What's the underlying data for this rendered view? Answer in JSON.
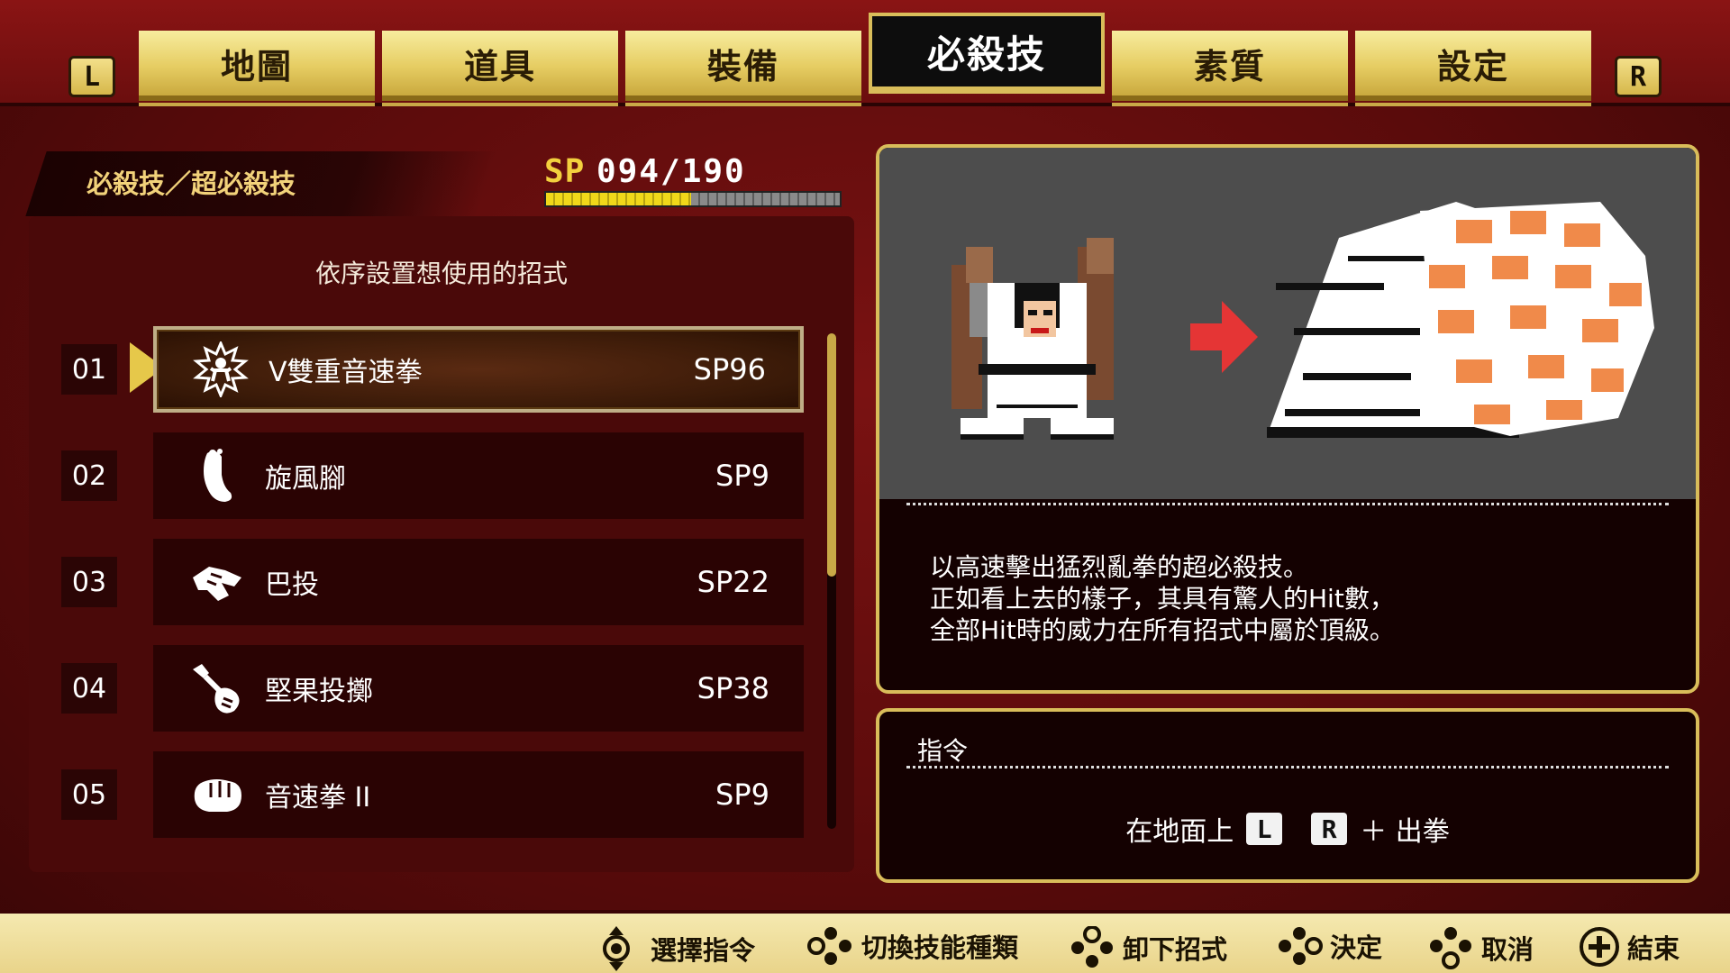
{
  "shoulder": {
    "left": "L",
    "right": "R"
  },
  "tabs": [
    {
      "label": "地圖"
    },
    {
      "label": "道具"
    },
    {
      "label": "裝備"
    },
    {
      "label": "必殺技"
    },
    {
      "label": "素質"
    },
    {
      "label": "設定"
    }
  ],
  "section": {
    "title": "必殺技／超必殺技"
  },
  "sp": {
    "label": "SP",
    "value": "094/190",
    "current": 94,
    "max": 190
  },
  "list": {
    "instruction": "依序設置想使用的招式",
    "items": [
      {
        "num": "01",
        "name": "V雙重音速拳",
        "cost": "SP96",
        "icon": "burst-figure-icon"
      },
      {
        "num": "02",
        "name": "旋風腳",
        "cost": "SP9",
        "icon": "foot-icon"
      },
      {
        "num": "03",
        "name": "巴投",
        "cost": "SP22",
        "icon": "grab-throw-icon"
      },
      {
        "num": "04",
        "name": "堅果投擲",
        "cost": "SP38",
        "icon": "throw-hand-icon"
      },
      {
        "num": "05",
        "name": "音速拳 II",
        "cost": "SP9",
        "icon": "fist-icon"
      }
    ]
  },
  "detail": {
    "description": [
      "以高速擊出猛烈亂拳的超必殺技。",
      "正如看上去的樣子，其具有驚人的Hit數，",
      "全部Hit時的威力在所有招式中屬於頂級。"
    ]
  },
  "command": {
    "title": "指令",
    "prefix": "在地面上",
    "key1": "L",
    "key2": "R",
    "suffix": "＋ 出拳"
  },
  "footer": {
    "hints": [
      {
        "label": "選擇指令",
        "icon": "dpad-updown-icon"
      },
      {
        "label": "切換技能種類",
        "icon": "buttons-left-icon"
      },
      {
        "label": "卸下招式",
        "icon": "buttons-top-icon"
      },
      {
        "label": "決定",
        "icon": "buttons-right-icon"
      },
      {
        "label": "取消",
        "icon": "buttons-bottom-icon"
      },
      {
        "label": "結束",
        "icon": "plus-button-icon"
      }
    ]
  },
  "colors": {
    "accent": "#d9bd5a",
    "panel": "#4a0909",
    "sp": "#f3d03e"
  }
}
